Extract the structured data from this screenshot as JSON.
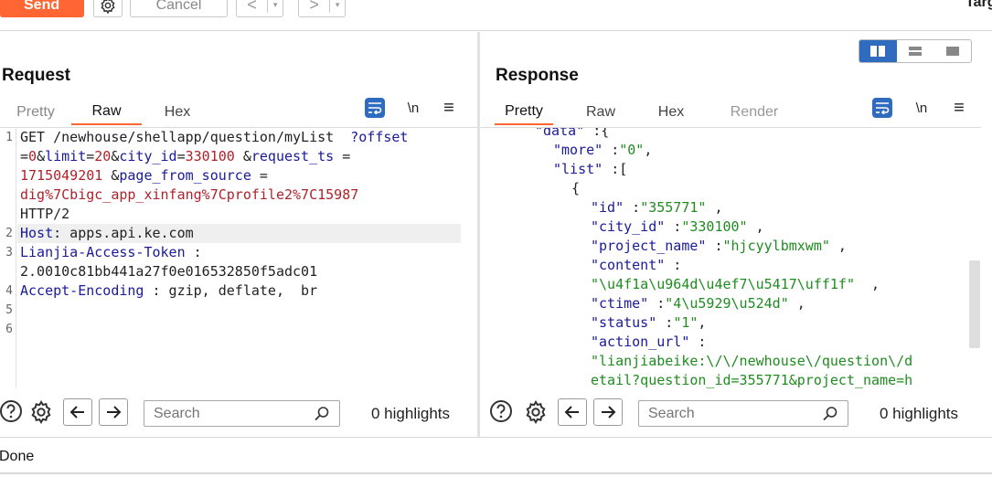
{
  "toolbar": {
    "send_label": "Send",
    "cancel_label": "Cancel",
    "back_glyph": "<",
    "forward_glyph": ">",
    "dropdown_glyph": "▾",
    "target_label": "Targ"
  },
  "request": {
    "title": "Request",
    "tabs": [
      "Pretty",
      "Raw",
      "Hex"
    ],
    "active_tab": "Raw",
    "newline_label": "\\n",
    "menu_glyph": "≡",
    "line_numbers": [
      "1",
      "2",
      "3",
      "4",
      "5",
      "6"
    ],
    "lines": [
      [
        {
          "t": "GET /newhouse/shellapp/question/myList  ",
          "c": "plain"
        },
        {
          "t": "?offset",
          "c": "key"
        }
      ],
      [
        {
          "t": "=",
          "c": "plain"
        },
        {
          "t": "0",
          "c": "val"
        },
        {
          "t": "&",
          "c": "plain"
        },
        {
          "t": "limit",
          "c": "key"
        },
        {
          "t": "=",
          "c": "plain"
        },
        {
          "t": "20",
          "c": "val"
        },
        {
          "t": "&",
          "c": "plain"
        },
        {
          "t": "city_id",
          "c": "key"
        },
        {
          "t": "=",
          "c": "plain"
        },
        {
          "t": "330100",
          "c": "val"
        },
        {
          "t": " &",
          "c": "plain"
        },
        {
          "t": "request_ts",
          "c": "key"
        },
        {
          "t": " =",
          "c": "plain"
        }
      ],
      [
        {
          "t": "1715049201",
          "c": "val"
        },
        {
          "t": " &",
          "c": "plain"
        },
        {
          "t": "page_from_source",
          "c": "key"
        },
        {
          "t": " =",
          "c": "plain"
        }
      ],
      [
        {
          "t": "dig%7Cbigc_app_xinfang%7Cprofile2%7C15987",
          "c": "val"
        }
      ],
      [
        {
          "t": "HTTP/2",
          "c": "plain"
        }
      ],
      [
        {
          "t": "Host",
          "c": "key"
        },
        {
          "t": ": apps.api.ke.com",
          "c": "plain"
        }
      ],
      [
        {
          "t": "Lianjia-Access-Token",
          "c": "key"
        },
        {
          "t": " :",
          "c": "plain"
        }
      ],
      [
        {
          "t": "2.0010c81bb441a27f0e016532850f5adc01",
          "c": "plain"
        }
      ],
      [
        {
          "t": "Accept-Encoding",
          "c": "key"
        },
        {
          "t": " : gzip, deflate,  br",
          "c": "plain"
        }
      ]
    ],
    "search_placeholder": "Search",
    "highlights": "0 highlights"
  },
  "response": {
    "title": "Response",
    "tabs": [
      "Pretty",
      "Raw",
      "Hex",
      "Render"
    ],
    "active_tab": "Pretty",
    "newline_label": "\\n",
    "menu_glyph": "≡",
    "lines": [
      [
        {
          "t": "\"data\"",
          "c": "jk"
        },
        {
          "t": " :{",
          "c": "plain"
        }
      ],
      [
        {
          "t": "\"more\"",
          "c": "jk"
        },
        {
          "t": " :",
          "c": "plain"
        },
        {
          "t": "\"0\"",
          "c": "str"
        },
        {
          "t": ",",
          "c": "plain"
        }
      ],
      [
        {
          "t": "\"list\"",
          "c": "jk"
        },
        {
          "t": " :[",
          "c": "plain"
        }
      ],
      [
        {
          "t": "{",
          "c": "plain"
        }
      ],
      [
        {
          "t": "\"id\"",
          "c": "jk"
        },
        {
          "t": " :",
          "c": "plain"
        },
        {
          "t": "\"355771\"",
          "c": "str"
        },
        {
          "t": " ,",
          "c": "plain"
        }
      ],
      [
        {
          "t": "\"city_id\"",
          "c": "jk"
        },
        {
          "t": " :",
          "c": "plain"
        },
        {
          "t": "\"330100\"",
          "c": "str"
        },
        {
          "t": " ,",
          "c": "plain"
        }
      ],
      [
        {
          "t": "\"project_name\"",
          "c": "jk"
        },
        {
          "t": " :",
          "c": "plain"
        },
        {
          "t": "\"hjcyylbmxwm\"",
          "c": "str"
        },
        {
          "t": " ,",
          "c": "plain"
        }
      ],
      [
        {
          "t": "\"content\"",
          "c": "jk"
        },
        {
          "t": " :",
          "c": "plain"
        }
      ],
      [
        {
          "t": "\"\\u4f1a\\u964d\\u4ef7\\u5417\\uff1f\"",
          "c": "str"
        },
        {
          "t": "  ,",
          "c": "plain"
        }
      ],
      [
        {
          "t": "\"ctime\"",
          "c": "jk"
        },
        {
          "t": " :",
          "c": "plain"
        },
        {
          "t": "\"4\\u5929\\u524d\"",
          "c": "str"
        },
        {
          "t": " ,",
          "c": "plain"
        }
      ],
      [
        {
          "t": "\"status\"",
          "c": "jk"
        },
        {
          "t": " :",
          "c": "plain"
        },
        {
          "t": "\"1\"",
          "c": "str"
        },
        {
          "t": ",",
          "c": "plain"
        }
      ],
      [
        {
          "t": "\"action_url\"",
          "c": "jk"
        },
        {
          "t": " :",
          "c": "plain"
        }
      ],
      [
        {
          "t": "\"lianjiabeike:\\/\\/newhouse\\/question\\/d",
          "c": "str"
        }
      ],
      [
        {
          "t": "etail?question_id=355771&project_name=h",
          "c": "str"
        }
      ]
    ],
    "search_placeholder": "Search",
    "highlights": "0 highlights"
  },
  "status": {
    "text": "Done"
  },
  "colors": {
    "accent": "#ff6633",
    "active_blue": "#2f6cbf"
  }
}
